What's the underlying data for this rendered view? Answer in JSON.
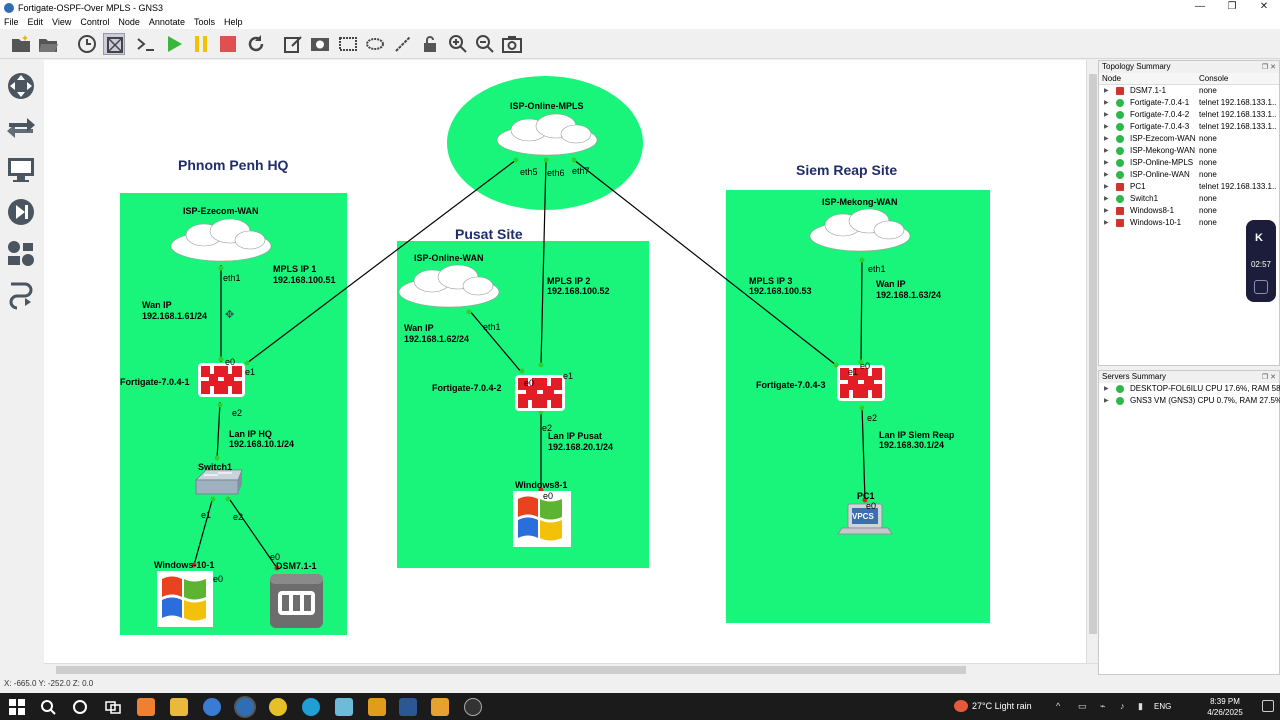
{
  "window": {
    "title": "Fortigate-OSPF-Over MPLS - GNS3",
    "controls": [
      "—",
      "❐",
      "✕"
    ]
  },
  "menu": [
    "File",
    "Edit",
    "View",
    "Control",
    "Node",
    "Annotate",
    "Tools",
    "Help"
  ],
  "toolbar_icons": [
    "new-project",
    "open-project",
    "snapshot",
    "show-interface-labels",
    "console-all",
    "start-all",
    "suspend-all",
    "stop-all",
    "reload-all",
    "add-note",
    "insert-picture",
    "draw-rectangle",
    "draw-ellipse",
    "draw-line",
    "lock-items",
    "zoom-in",
    "zoom-out",
    "screenshot"
  ],
  "regions": {
    "hq": "Phnom Penh HQ",
    "pusat": "Pusat Site",
    "siem": "Siem Reap Site"
  },
  "clouds": {
    "mpls": "ISP-Online-MPLS",
    "ezecom": "ISP-Ezecom-WAN",
    "online_wan": "ISP-Online-WAN",
    "mekong": "ISP-Mekong-WAN"
  },
  "devices": {
    "fg1": "Fortigate-7.0.4-1",
    "fg2": "Fortigate-7.0.4-2",
    "fg3": "Fortigate-7.0.4-3",
    "switch": "Switch1",
    "win10": "Windows-10-1",
    "dsm": "DSM7.1-1",
    "win8": "Windows8-1",
    "pc1": "PC1"
  },
  "ports": {
    "eth5": "eth5",
    "eth6": "eth6",
    "eth7": "eth7",
    "eth1": "eth1",
    "e0": "e0",
    "e1": "e1",
    "e2": "e2"
  },
  "annotations": {
    "mpls1_title": "MPLS IP 1",
    "mpls1_ip": "192.168.100.51",
    "mpls2_title": "MPLS IP 2",
    "mpls2_ip": "192.168.100.52",
    "mpls3_title": "MPLS IP 3",
    "mpls3_ip": "192.168.100.53",
    "wan_title": "Wan IP",
    "wan1_ip": "192.168.1.61/24",
    "wan2_ip": "192.168.1.62/24",
    "wan3_ip": "192.168.1.63/24",
    "lan_hq_title": "Lan IP HQ",
    "lan_hq_ip": "192.168.10.1/24",
    "lan_pusat_title": "Lan IP Pusat",
    "lan_pusat_ip": "192.168.20.1/24",
    "lan_siem_title": "Lan IP Siem Reap",
    "lan_siem_ip": "192.168.30.1/24"
  },
  "vpcs_label": "VPCS",
  "topology_summary": {
    "title": "Topology Summary",
    "col_node": "Node",
    "col_console": "Console",
    "rows": [
      {
        "name": "DSM7.1-1",
        "console": "none",
        "status": "stopped"
      },
      {
        "name": "Fortigate-7.0.4-1",
        "console": "telnet 192.168.133.1...",
        "status": "started"
      },
      {
        "name": "Fortigate-7.0.4-2",
        "console": "telnet 192.168.133.1...",
        "status": "started"
      },
      {
        "name": "Fortigate-7.0.4-3",
        "console": "telnet 192.168.133.1...",
        "status": "started"
      },
      {
        "name": "ISP-Ezecom-WAN",
        "console": "none",
        "status": "started"
      },
      {
        "name": "ISP-Mekong-WAN",
        "console": "none",
        "status": "started"
      },
      {
        "name": "ISP-Online-MPLS",
        "console": "none",
        "status": "started"
      },
      {
        "name": "ISP-Online-WAN",
        "console": "none",
        "status": "started"
      },
      {
        "name": "PC1",
        "console": "telnet 192.168.133.1...",
        "status": "stopped"
      },
      {
        "name": "Switch1",
        "console": "none",
        "status": "started"
      },
      {
        "name": "Windows8-1",
        "console": "none",
        "status": "stopped"
      },
      {
        "name": "Windows-10-1",
        "console": "none",
        "status": "stopped"
      }
    ]
  },
  "servers_summary": {
    "title": "Servers Summary",
    "rows": [
      "DESKTOP-FOL6ILU CPU 17.6%, RAM 58....",
      "GNS3 VM (GNS3) CPU 0.7%, RAM 27.5%"
    ]
  },
  "status_bar": "X: -665.0 Y: -252.0 Z: 0.0",
  "widget": {
    "letter": "K",
    "time": "02:57"
  },
  "taskbar": {
    "weather": "27°C  Light rain",
    "lang": "ENG",
    "time": "8:39 PM",
    "date": "4/26/2025"
  },
  "colors": {
    "site_green": "#19f57b",
    "link": "#000000",
    "status_green": "#2db84a",
    "status_red": "#d0342c",
    "title_blue": "#1f2d6b"
  }
}
